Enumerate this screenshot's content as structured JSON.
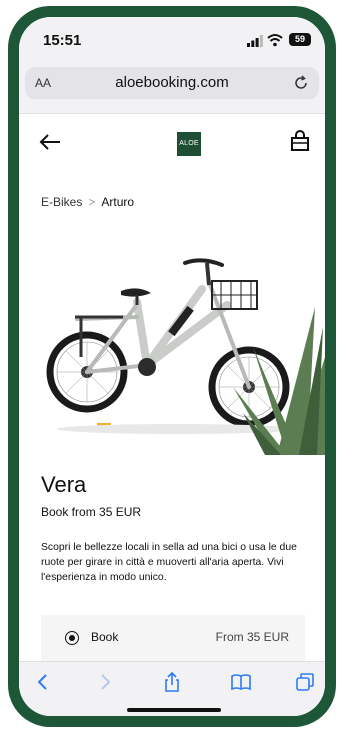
{
  "status": {
    "time": "15:51",
    "battery": "59"
  },
  "browser": {
    "text_size": "AA",
    "url": "aloebooking.com"
  },
  "header": {
    "logo_text": "ALOE",
    "icons": [
      "back-arrow-icon",
      "shopping-bag-icon"
    ]
  },
  "breadcrumb": {
    "parent": "E-Bikes",
    "separator": ">",
    "current": "Arturo"
  },
  "product": {
    "name": "Vera",
    "subtitle": "Book from 35 EUR",
    "description": "Scopri le bellezze locali in sella ad una bici o usa le due ruote per girare in città e muoverti all'aria aperta. Vivi l'esperienza in modo unico.",
    "option": {
      "label": "Book",
      "price": "From 35 EUR",
      "selected": true
    }
  },
  "toolbar": {
    "icons": [
      "back-icon",
      "forward-icon",
      "share-icon",
      "bookmarks-icon",
      "tabs-icon"
    ]
  },
  "colors": {
    "frame": "#1d5737",
    "logo": "#1e4f35",
    "toolbar_icon": "#2f7bf5"
  }
}
